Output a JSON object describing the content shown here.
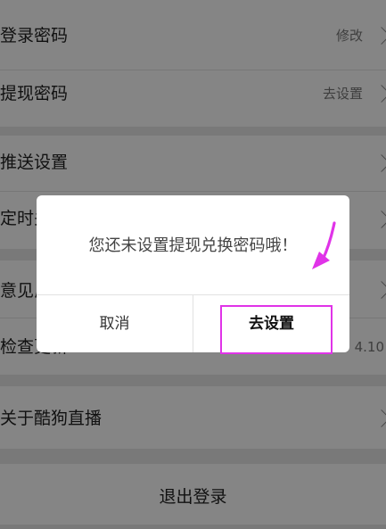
{
  "settings": {
    "items": [
      {
        "label": "登录密码",
        "value": "修改"
      },
      {
        "label": "提现密码",
        "value": "去设置"
      },
      {
        "label": "推送设置",
        "value": ""
      },
      {
        "label": "定时关闭",
        "value": ""
      },
      {
        "label": "意见反馈",
        "value": ""
      },
      {
        "label": "检查更新",
        "value": "4.10"
      },
      {
        "label": "关于酷狗直播",
        "value": ""
      }
    ],
    "logout_label": "退出登录"
  },
  "dialog": {
    "message": "您还未设置提现兑换密码哦！",
    "cancel_label": "取消",
    "confirm_label": "去设置"
  },
  "annotation": {
    "color": "#e033e8"
  }
}
